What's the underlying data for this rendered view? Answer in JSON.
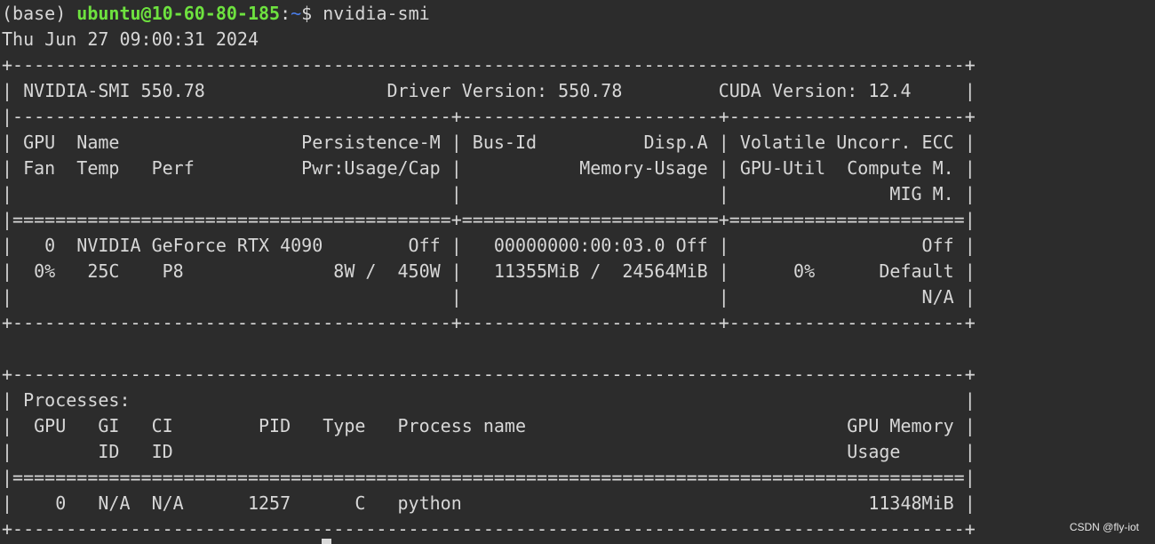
{
  "prompt": {
    "env": "(base) ",
    "user_host": "ubuntu@10-60-80-185",
    "colon": ":",
    "path": "~",
    "symbol": "$ ",
    "command": "nvidia-smi"
  },
  "output_lines": [
    "Thu Jun 27 09:00:31 2024       ",
    "+-----------------------------------------------------------------------------------------+",
    "| NVIDIA-SMI 550.78                 Driver Version: 550.78         CUDA Version: 12.4     |",
    "|-----------------------------------------+------------------------+----------------------+",
    "| GPU  Name                 Persistence-M | Bus-Id          Disp.A | Volatile Uncorr. ECC |",
    "| Fan  Temp   Perf          Pwr:Usage/Cap |           Memory-Usage | GPU-Util  Compute M. |",
    "|                                         |                        |               MIG M. |",
    "|=========================================+========================+======================|",
    "|   0  NVIDIA GeForce RTX 4090        Off |   00000000:00:03.0 Off |                  Off |",
    "|  0%   25C    P8              8W /  450W |   11355MiB /  24564MiB |      0%      Default |",
    "|                                         |                        |                  N/A |",
    "+-----------------------------------------+------------------------+----------------------+",
    "                                                                                         ",
    "+-----------------------------------------------------------------------------------------+",
    "| Processes:                                                                              |",
    "|  GPU   GI   CI        PID   Type   Process name                              GPU Memory |",
    "|        ID   ID                                                               Usage      |",
    "|=========================================================================================|",
    "|    0   N/A  N/A      1257      C   python                                      11348MiB |",
    "+-----------------------------------------------------------------------------------------+"
  ],
  "watermark": "CSDN @fly-iot",
  "colors": {
    "background": "#2c2c2c",
    "text": "#d7d7d7",
    "user_host": "#6ee23f",
    "path": "#4a7de8"
  }
}
